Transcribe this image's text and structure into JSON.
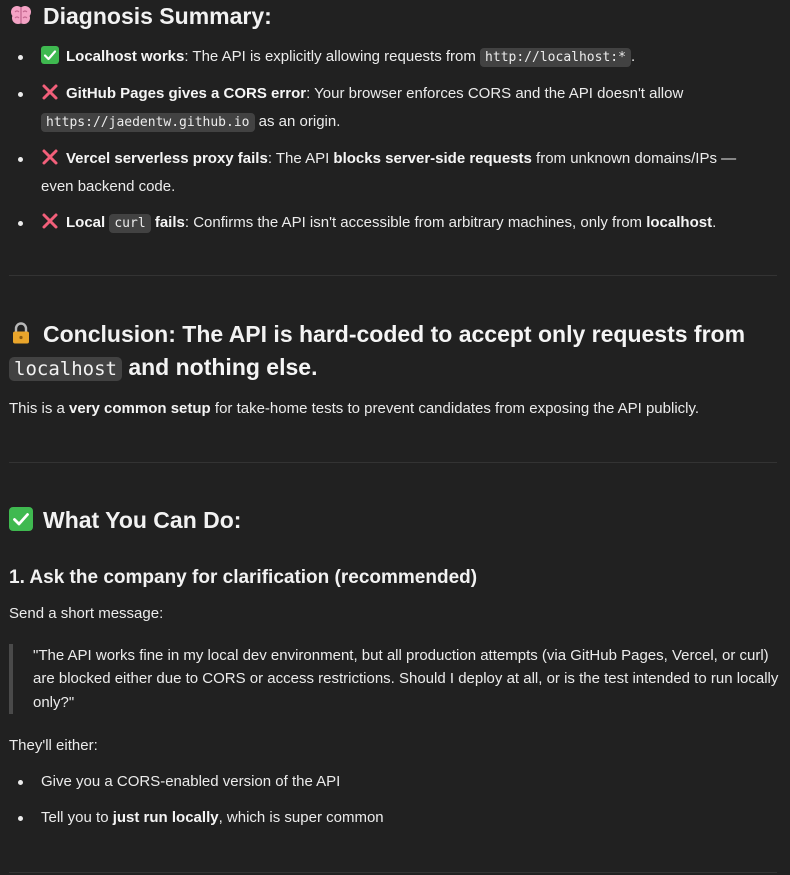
{
  "diagnosis": {
    "title": "Diagnosis Summary:",
    "items": [
      {
        "label": "Localhost works",
        "text1": ": The API is explicitly allowing requests from ",
        "code": "http://localhost:*",
        "text2": "."
      },
      {
        "label": "GitHub Pages gives a CORS error",
        "text1": ": Your browser enforces CORS and the API doesn't allow",
        "code": "https://jaedentw.github.io",
        "text2": " as an origin."
      },
      {
        "label": "Vercel serverless proxy fails",
        "text1": ": The API ",
        "bold": "blocks server-side requests",
        "text2": " from unknown domains/IPs —",
        "text3": "even backend code."
      },
      {
        "label_a": "Local ",
        "code": "curl",
        "label_b": " fails",
        "text1": ": Confirms the API isn't accessible from arbitrary machines, only from ",
        "bold": "localhost",
        "text2": "."
      }
    ]
  },
  "conclusion": {
    "title_prefix": "Conclusion: The API is ",
    "title_bold": "hard-coded to accept only requests from",
    "title_code": "localhost",
    "title_mid": " and ",
    "title_bold2": "nothing else",
    "title_end": ".",
    "para_a": "This is a ",
    "para_bold": "very common setup",
    "para_b": " for take-home tests to prevent candidates from exposing the API publicly."
  },
  "actions": {
    "title": "What You Can Do:",
    "subtitle": "1. Ask the company for clarification (recommended)",
    "intro": "Send a short message:",
    "quote": "\"The API works fine in my local dev environment, but all production attempts (via GitHub Pages, Vercel, or curl) are blocked either due to CORS or access restrictions. Should I deploy at all, or is the test intended to run locally only?\"",
    "outro": "They'll either:",
    "options": [
      {
        "text": "Give you a CORS-enabled version of the API"
      },
      {
        "text_a": "Tell you to ",
        "bold": "just run locally",
        "text_b": ", which is super common"
      }
    ]
  },
  "colors": {
    "background": "#212121",
    "check_green": "#3fb950",
    "cross_red": "#f25f7a",
    "lock_gold": "#e9a52b",
    "brain_pink": "#f4a3c5"
  },
  "icons": [
    "brain-icon",
    "check-mark-icon",
    "cross-mark-icon",
    "lock-icon"
  ]
}
